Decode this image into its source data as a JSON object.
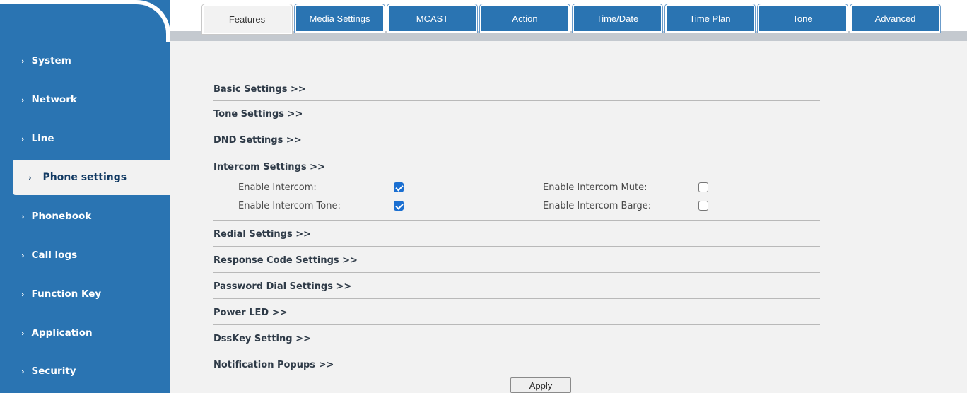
{
  "sidebar": {
    "items": [
      {
        "label": "System"
      },
      {
        "label": "Network"
      },
      {
        "label": "Line"
      },
      {
        "label": "Phone settings"
      },
      {
        "label": "Phonebook"
      },
      {
        "label": "Call logs"
      },
      {
        "label": "Function Key"
      },
      {
        "label": "Application"
      },
      {
        "label": "Security"
      }
    ],
    "active": "Phone settings",
    "chevron": "›"
  },
  "tabs": [
    {
      "label": "Features"
    },
    {
      "label": "Media Settings"
    },
    {
      "label": "MCAST"
    },
    {
      "label": "Action"
    },
    {
      "label": "Time/Date"
    },
    {
      "label": "Time Plan"
    },
    {
      "label": "Tone"
    },
    {
      "label": "Advanced"
    }
  ],
  "active_tab": "Features",
  "sections": [
    {
      "title": "Basic Settings >>"
    },
    {
      "title": "Tone Settings >>"
    },
    {
      "title": "DND Settings >>"
    },
    {
      "title": "Intercom Settings >>"
    },
    {
      "title": "Redial Settings >>"
    },
    {
      "title": "Response Code Settings >>"
    },
    {
      "title": "Password Dial Settings >>"
    },
    {
      "title": "Power LED >>"
    },
    {
      "title": "DssKey Setting >>"
    },
    {
      "title": "Notification Popups >>"
    }
  ],
  "intercom": {
    "enable_intercom": {
      "label": "Enable Intercom:",
      "checked": true
    },
    "enable_intercom_tone": {
      "label": "Enable Intercom Tone:",
      "checked": true
    },
    "enable_intercom_mute": {
      "label": "Enable Intercom Mute:",
      "checked": false
    },
    "enable_intercom_barge": {
      "label": "Enable Intercom Barge:",
      "checked": false
    }
  },
  "apply_label": "Apply",
  "colors": {
    "sidebar": "#2a74b2",
    "content_bg": "#f2f2f2",
    "checkbox_on": "#1b6fd1"
  }
}
